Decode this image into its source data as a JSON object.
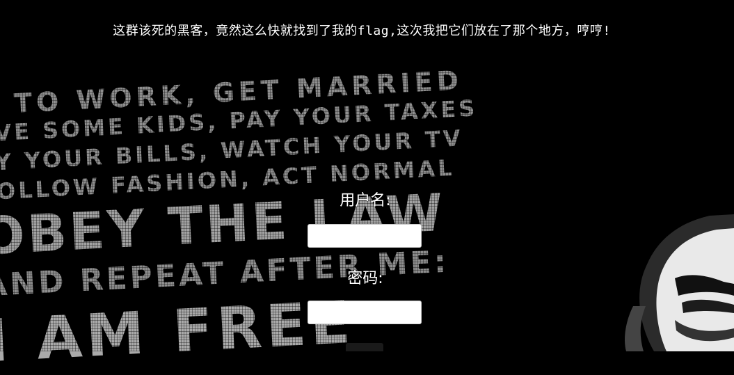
{
  "header": {
    "message": "这群该死的黑客，竟然这么快就找到了我的flag,这次我把它们放在了那个地方，哼哼!"
  },
  "background": {
    "lines": [
      "O TO WORK, GET MARRIED",
      "AVE SOME KIDS, PAY YOUR TAXES",
      "AY YOUR BILLS, WATCH YOUR TV",
      "FOLLOW FASHION, ACT NORMAL",
      "OBEY THE LAW",
      "AND REPEAT AFTER ME:",
      "I AM FREE"
    ]
  },
  "form": {
    "username_label": "用户名:",
    "username_value": "",
    "password_label": "密码:",
    "password_value": ""
  }
}
